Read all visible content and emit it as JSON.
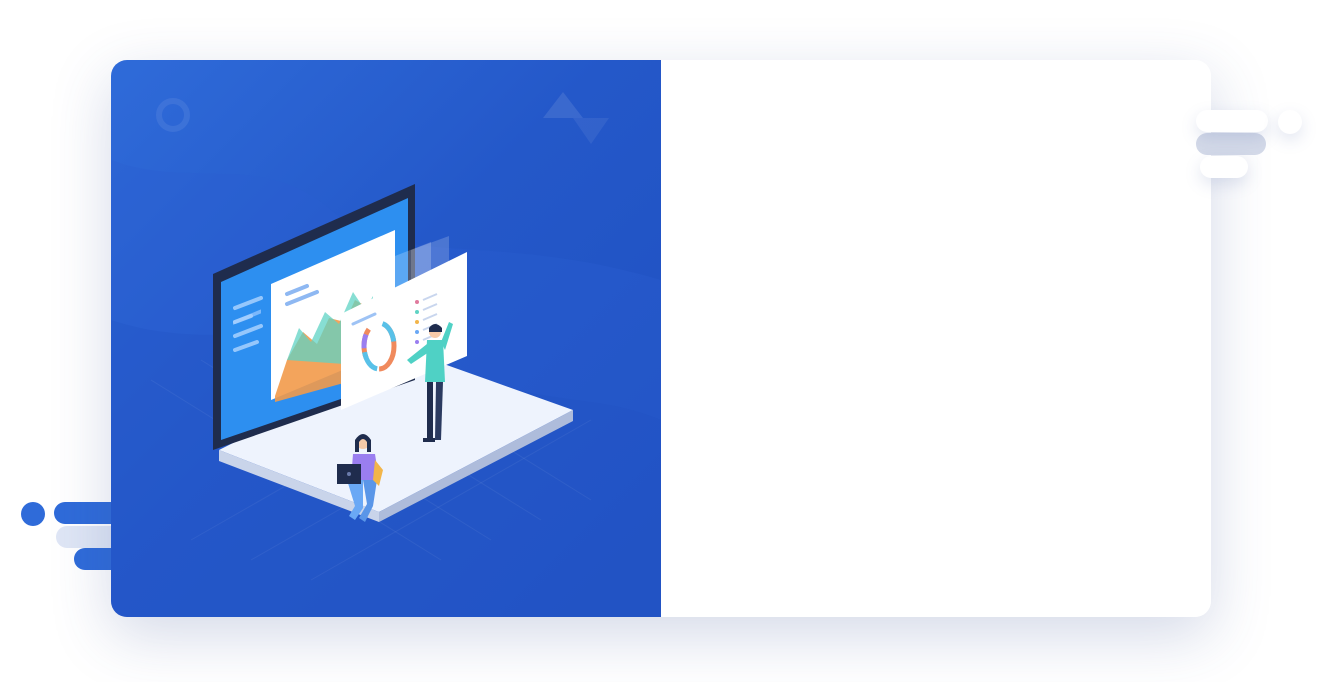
{
  "colors": {
    "panel_blue": "#2458c9",
    "accent_blue": "#2f6bd9",
    "card_background": "#ffffff",
    "chart_orange": "#f29a4a",
    "chart_teal": "#5fd3c4"
  },
  "illustration": {
    "name": "analytics-dashboard-illustration"
  },
  "right_panel": {}
}
